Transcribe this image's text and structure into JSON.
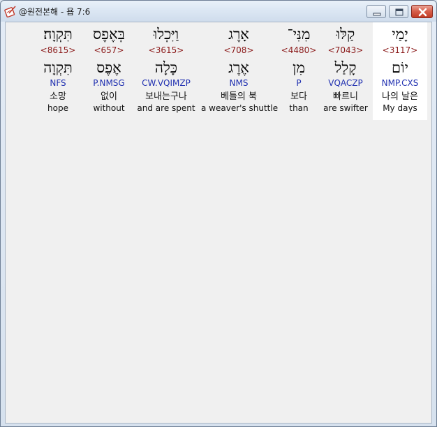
{
  "window": {
    "title": "@원전본해 - 욥 7:6"
  },
  "icons": {
    "app": "pen-book-icon",
    "minimize": "minimize-icon",
    "maximize": "maximize-icon",
    "close": "close-icon"
  },
  "colors": {
    "strong_number": "#8b1a1a",
    "morphology": "#1f2fb0",
    "selected_column": "#ffffff"
  },
  "words": [
    {
      "hebrew": "יָמַי",
      "strong": "<3117>",
      "lemma": "יוֹם",
      "morph": "NMP.CXS",
      "korean": "나의 날은",
      "english": "My days"
    },
    {
      "hebrew": "קַלּוּ",
      "strong": "<7043>",
      "lemma": "קָלַל",
      "morph": "VQACZP",
      "korean": "빠르니",
      "english": "are swifter"
    },
    {
      "hebrew": "מִנִּי־",
      "strong": "<4480>",
      "lemma": "מִן",
      "morph": "P",
      "korean": "보다",
      "english": "than"
    },
    {
      "hebrew": "אָרֶג",
      "strong": "<708>",
      "lemma": "אֶרֶג",
      "morph": "NMS",
      "korean": "베틀의 북",
      "english": "a weaver's shuttle"
    },
    {
      "hebrew": "וַיִּכְלוּ",
      "strong": "<3615>",
      "lemma": "כָּלָה",
      "morph": "CW.VQIMZP",
      "korean": "보내는구나",
      "english": "and are spent"
    },
    {
      "hebrew": "בְּאֶפֶס",
      "strong": "<657>",
      "lemma": "אֶפֶס",
      "morph": "P.NMSG",
      "korean": "없이",
      "english": "without"
    },
    {
      "hebrew": "תִּקְוָה׃",
      "strong": "<8615>",
      "lemma": "תִּקְוָה",
      "morph": "NFS",
      "korean": "소망",
      "english": "hope"
    }
  ]
}
